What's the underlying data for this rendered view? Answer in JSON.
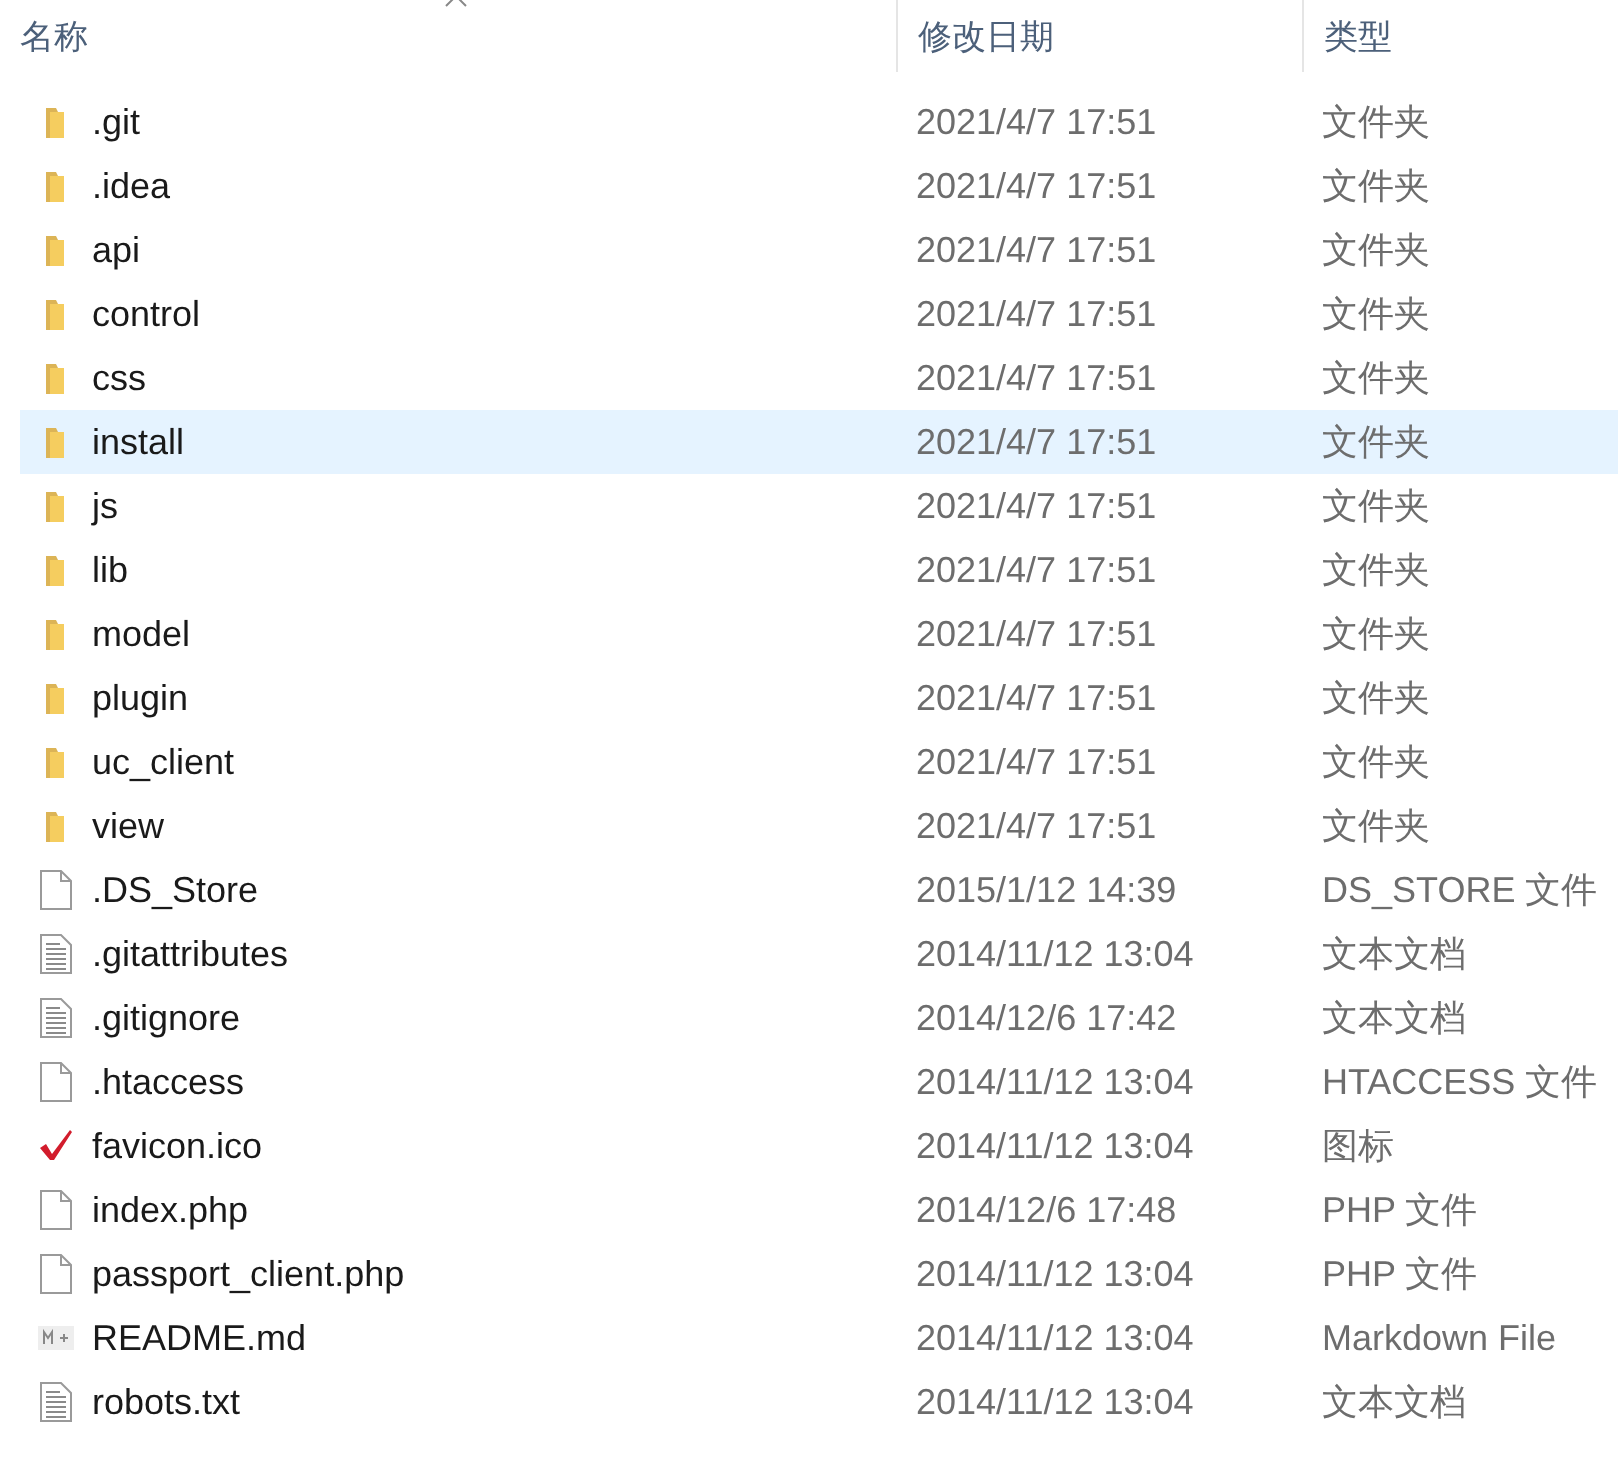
{
  "columns": [
    "名称",
    "修改日期",
    "类型"
  ],
  "rows": [
    {
      "name": ".git",
      "date": "2021/4/7 17:51",
      "type": "文件夹",
      "kind": "folder",
      "selected": false
    },
    {
      "name": ".idea",
      "date": "2021/4/7 17:51",
      "type": "文件夹",
      "kind": "folder",
      "selected": false
    },
    {
      "name": "api",
      "date": "2021/4/7 17:51",
      "type": "文件夹",
      "kind": "folder",
      "selected": false
    },
    {
      "name": "control",
      "date": "2021/4/7 17:51",
      "type": "文件夹",
      "kind": "folder",
      "selected": false
    },
    {
      "name": "css",
      "date": "2021/4/7 17:51",
      "type": "文件夹",
      "kind": "folder",
      "selected": false
    },
    {
      "name": "install",
      "date": "2021/4/7 17:51",
      "type": "文件夹",
      "kind": "folder",
      "selected": true
    },
    {
      "name": "js",
      "date": "2021/4/7 17:51",
      "type": "文件夹",
      "kind": "folder",
      "selected": false
    },
    {
      "name": "lib",
      "date": "2021/4/7 17:51",
      "type": "文件夹",
      "kind": "folder",
      "selected": false
    },
    {
      "name": "model",
      "date": "2021/4/7 17:51",
      "type": "文件夹",
      "kind": "folder",
      "selected": false
    },
    {
      "name": "plugin",
      "date": "2021/4/7 17:51",
      "type": "文件夹",
      "kind": "folder",
      "selected": false
    },
    {
      "name": "uc_client",
      "date": "2021/4/7 17:51",
      "type": "文件夹",
      "kind": "folder",
      "selected": false
    },
    {
      "name": "view",
      "date": "2021/4/7 17:51",
      "type": "文件夹",
      "kind": "folder",
      "selected": false
    },
    {
      "name": ".DS_Store",
      "date": "2015/1/12 14:39",
      "type": "DS_STORE 文件",
      "kind": "file",
      "selected": false
    },
    {
      "name": ".gitattributes",
      "date": "2014/11/12 13:04",
      "type": "文本文档",
      "kind": "text",
      "selected": false
    },
    {
      "name": ".gitignore",
      "date": "2014/12/6 17:42",
      "type": "文本文档",
      "kind": "text",
      "selected": false
    },
    {
      "name": ".htaccess",
      "date": "2014/11/12 13:04",
      "type": "HTACCESS 文件",
      "kind": "file",
      "selected": false
    },
    {
      "name": "favicon.ico",
      "date": "2014/11/12 13:04",
      "type": "图标",
      "kind": "check",
      "selected": false
    },
    {
      "name": "index.php",
      "date": "2014/12/6 17:48",
      "type": "PHP 文件",
      "kind": "file",
      "selected": false
    },
    {
      "name": "passport_client.php",
      "date": "2014/11/12 13:04",
      "type": "PHP 文件",
      "kind": "file",
      "selected": false
    },
    {
      "name": "README.md",
      "date": "2014/11/12 13:04",
      "type": "Markdown File",
      "kind": "markdown",
      "selected": false
    },
    {
      "name": "robots.txt",
      "date": "2014/11/12 13:04",
      "type": "文本文档",
      "kind": "text",
      "selected": false
    }
  ]
}
